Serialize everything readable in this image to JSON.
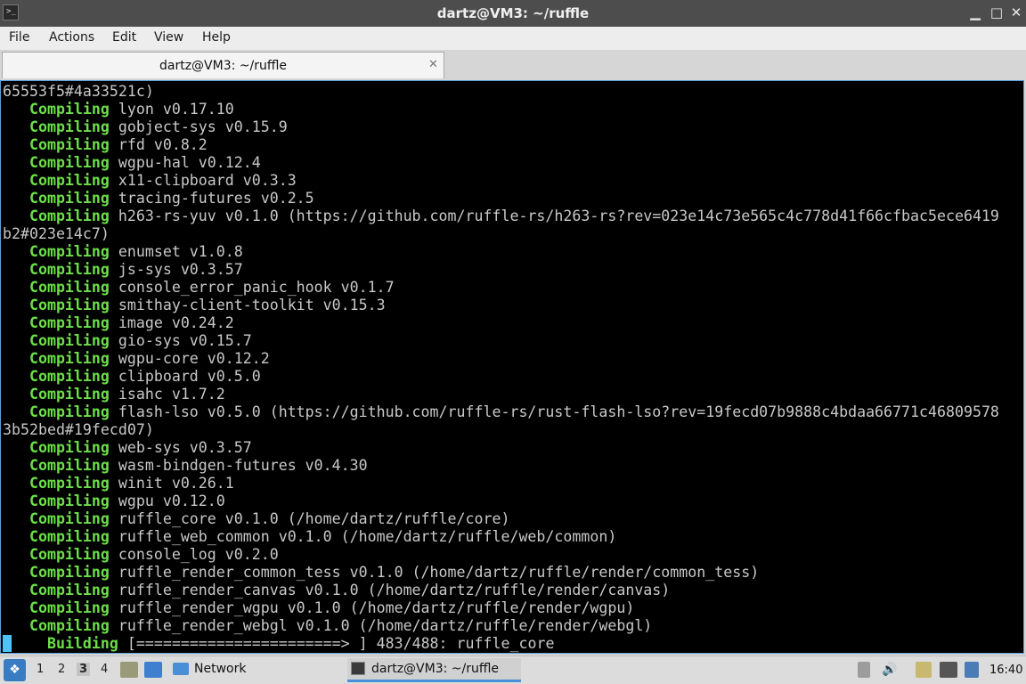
{
  "window": {
    "title": "dartz@VM3: ~/ruffle",
    "controls": {
      "minimize": "▁",
      "maximize": "□",
      "close": "✕"
    },
    "app_icon": ">_"
  },
  "menu": [
    "File",
    "Actions",
    "Edit",
    "View",
    "Help"
  ],
  "tab": {
    "label": "dartz@VM3: ~/ruffle",
    "close": "✕"
  },
  "terminal": {
    "lines": [
      {
        "kw": "",
        "text": "65553f5#4a33521c)"
      },
      {
        "kw": "   Compiling",
        "text": " lyon v0.17.10"
      },
      {
        "kw": "   Compiling",
        "text": " gobject-sys v0.15.9"
      },
      {
        "kw": "   Compiling",
        "text": " rfd v0.8.2"
      },
      {
        "kw": "   Compiling",
        "text": " wgpu-hal v0.12.4"
      },
      {
        "kw": "   Compiling",
        "text": " x11-clipboard v0.3.3"
      },
      {
        "kw": "   Compiling",
        "text": " tracing-futures v0.2.5"
      },
      {
        "kw": "   Compiling",
        "text": " h263-rs-yuv v0.1.0 (https://github.com/ruffle-rs/h263-rs?rev=023e14c73e565c4c778d41f66cfbac5ece6419"
      },
      {
        "kw": "",
        "text": "b2#023e14c7)"
      },
      {
        "kw": "   Compiling",
        "text": " enumset v1.0.8"
      },
      {
        "kw": "   Compiling",
        "text": " js-sys v0.3.57"
      },
      {
        "kw": "   Compiling",
        "text": " console_error_panic_hook v0.1.7"
      },
      {
        "kw": "   Compiling",
        "text": " smithay-client-toolkit v0.15.3"
      },
      {
        "kw": "   Compiling",
        "text": " image v0.24.2"
      },
      {
        "kw": "   Compiling",
        "text": " gio-sys v0.15.7"
      },
      {
        "kw": "   Compiling",
        "text": " wgpu-core v0.12.2"
      },
      {
        "kw": "   Compiling",
        "text": " clipboard v0.5.0"
      },
      {
        "kw": "   Compiling",
        "text": " isahc v1.7.2"
      },
      {
        "kw": "   Compiling",
        "text": " flash-lso v0.5.0 (https://github.com/ruffle-rs/rust-flash-lso?rev=19fecd07b9888c4bdaa66771c46809578"
      },
      {
        "kw": "",
        "text": "3b52bed#19fecd07)"
      },
      {
        "kw": "   Compiling",
        "text": " web-sys v0.3.57"
      },
      {
        "kw": "   Compiling",
        "text": " wasm-bindgen-futures v0.4.30"
      },
      {
        "kw": "   Compiling",
        "text": " winit v0.26.1"
      },
      {
        "kw": "   Compiling",
        "text": " wgpu v0.12.0"
      },
      {
        "kw": "   Compiling",
        "text": " ruffle_core v0.1.0 (/home/dartz/ruffle/core)"
      },
      {
        "kw": "   Compiling",
        "text": " ruffle_web_common v0.1.0 (/home/dartz/ruffle/web/common)"
      },
      {
        "kw": "   Compiling",
        "text": " console_log v0.2.0"
      },
      {
        "kw": "   Compiling",
        "text": " ruffle_render_common_tess v0.1.0 (/home/dartz/ruffle/render/common_tess)"
      },
      {
        "kw": "   Compiling",
        "text": " ruffle_render_canvas v0.1.0 (/home/dartz/ruffle/render/canvas)"
      },
      {
        "kw": "   Compiling",
        "text": " ruffle_render_wgpu v0.1.0 (/home/dartz/ruffle/render/wgpu)"
      },
      {
        "kw": "   Compiling",
        "text": " ruffle_render_webgl v0.1.0 (/home/dartz/ruffle/render/webgl)"
      }
    ],
    "progress": {
      "kw": "    Building",
      "bar": " [=======================> ]",
      "count": " 483/488:",
      "crate": " ruffle_core",
      "done": 483,
      "total": 488
    }
  },
  "taskbar": {
    "start_icon": "❖",
    "workspaces": [
      "1",
      "2",
      "3",
      "4"
    ],
    "active_workspace": "3",
    "network_label": "Network",
    "task_label": "dartz@VM3: ~/ruffle",
    "tray": {
      "volume": "🔊"
    },
    "clock": "16:40"
  }
}
